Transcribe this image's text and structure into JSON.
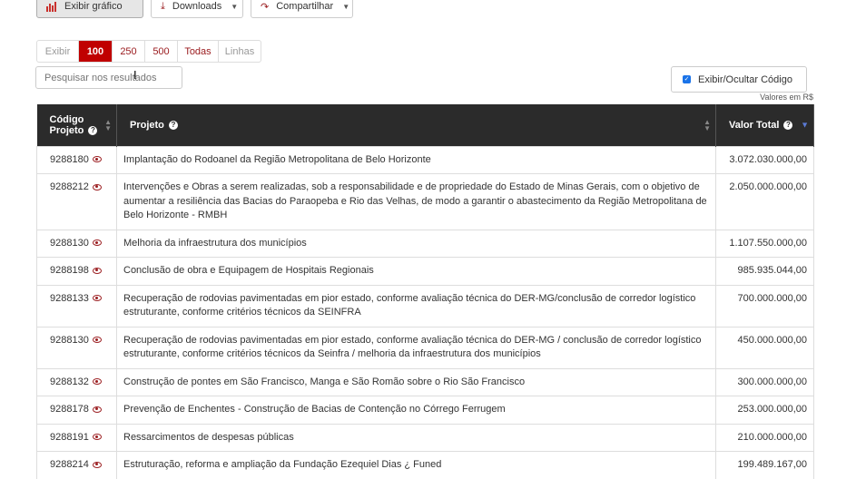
{
  "toolbar": {
    "chart_label": "Exibir gráfico",
    "downloads_label": "Downloads",
    "share_label": "Compartilhar"
  },
  "pager": {
    "label": "Exibir",
    "options": [
      "100",
      "250",
      "500",
      "Todas"
    ],
    "active": "100",
    "suffix": "Linhas"
  },
  "search": {
    "placeholder": "Pesquisar nos resultados"
  },
  "toggle": {
    "label": "Exibir/Ocultar Código",
    "checked": true
  },
  "note": "Valores em R$",
  "table": {
    "headers": {
      "code_line1": "Código",
      "code_line2": "Projeto",
      "project": "Projeto",
      "value": "Valor Total"
    },
    "rows": [
      {
        "code": "9288180",
        "project": "Implantação do Rodoanel da Região Metropolitana de Belo Horizonte",
        "value": "3.072.030.000,00"
      },
      {
        "code": "9288212",
        "project": "Intervenções e Obras a serem realizadas, sob a responsabilidade e de propriedade do Estado de Minas Gerais, com o objetivo de aumentar a resiliência das Bacias do Paraopeba e Rio das Velhas, de modo a garantir o abastecimento da Região Metropolitana de Belo Horizonte - RMBH",
        "value": "2.050.000.000,00"
      },
      {
        "code": "9288130",
        "project": "Melhoria da infraestrutura dos municípios",
        "value": "1.107.550.000,00"
      },
      {
        "code": "9288198",
        "project": "Conclusão de obra e Equipagem de Hospitais Regionais",
        "value": "985.935.044,00"
      },
      {
        "code": "9288133",
        "project": "Recuperação de rodovias pavimentadas em pior estado, conforme avaliação técnica do DER-MG/conclusão de corredor logístico estruturante, conforme critérios técnicos da SEINFRA",
        "value": "700.000.000,00"
      },
      {
        "code": "9288130",
        "project": "Recuperação de rodovias pavimentadas em pior estado, conforme avaliação técnica do DER-MG / conclusão de corredor logístico estruturante, conforme critérios técnicos da Seinfra / melhoria da infraestrutura dos municípios",
        "value": "450.000.000,00"
      },
      {
        "code": "9288132",
        "project": "Construção de pontes em São Francisco, Manga e São Romão sobre o Rio São Francisco",
        "value": "300.000.000,00"
      },
      {
        "code": "9288178",
        "project": "Prevenção de Enchentes - Construção de Bacias de Contenção no Córrego Ferrugem",
        "value": "253.000.000,00"
      },
      {
        "code": "9288191",
        "project": "Ressarcimentos de despesas públicas",
        "value": "210.000.000,00"
      },
      {
        "code": "9288214",
        "project": "Estruturação, reforma e ampliação da Fundação Ezequiel Dias ¿ Funed",
        "value": "199.489.167,00"
      }
    ]
  }
}
